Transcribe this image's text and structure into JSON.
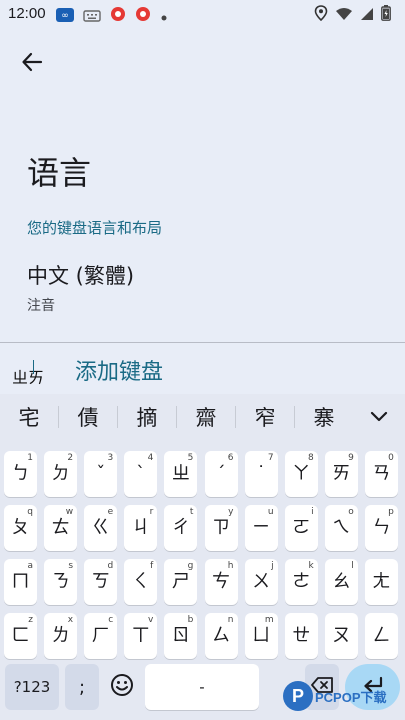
{
  "status_bar": {
    "time": "12:00",
    "left_icons": [
      "infinity-app-icon",
      "keyboard-notification-icon",
      "app-notification-icon",
      "app-notification-icon",
      "more-dot-icon"
    ],
    "right_icons": [
      "location-icon",
      "wifi-icon",
      "signal-icon",
      "battery-icon"
    ]
  },
  "header": {
    "back_icon": "arrow-back-icon"
  },
  "page": {
    "title": "语言",
    "section_label": "您的键盘语言和布局",
    "language_name": "中文 (繁體)",
    "language_layout": "注音",
    "add_keyboard": "添加键盘"
  },
  "composing_text": "ㄓㄞ",
  "candidates": [
    "宅",
    "債",
    "摘",
    "齋",
    "窄",
    "寨"
  ],
  "keyboard": {
    "rows": [
      [
        {
          "k": "ㄅ",
          "h": "1"
        },
        {
          "k": "ㄉ",
          "h": "2"
        },
        {
          "k": "ˇ",
          "h": "3"
        },
        {
          "k": "ˋ",
          "h": "4"
        },
        {
          "k": "ㄓ",
          "h": "5"
        },
        {
          "k": "ˊ",
          "h": "6"
        },
        {
          "k": "˙",
          "h": "7"
        },
        {
          "k": "ㄚ",
          "h": "8"
        },
        {
          "k": "ㄞ",
          "h": "9"
        },
        {
          "k": "ㄢ",
          "h": "0"
        }
      ],
      [
        {
          "k": "ㄆ",
          "h": "q"
        },
        {
          "k": "ㄊ",
          "h": "w"
        },
        {
          "k": "ㄍ",
          "h": "e"
        },
        {
          "k": "ㄐ",
          "h": "r"
        },
        {
          "k": "ㄔ",
          "h": "t"
        },
        {
          "k": "ㄗ",
          "h": "y"
        },
        {
          "k": "ㄧ",
          "h": "u"
        },
        {
          "k": "ㄛ",
          "h": "i"
        },
        {
          "k": "ㄟ",
          "h": "o"
        },
        {
          "k": "ㄣ",
          "h": "p"
        }
      ],
      [
        {
          "k": "ㄇ",
          "h": "a"
        },
        {
          "k": "ㄋ",
          "h": "s"
        },
        {
          "k": "ㄎ",
          "h": "d"
        },
        {
          "k": "ㄑ",
          "h": "f"
        },
        {
          "k": "ㄕ",
          "h": "g"
        },
        {
          "k": "ㄘ",
          "h": "h"
        },
        {
          "k": "ㄨ",
          "h": "j"
        },
        {
          "k": "ㄜ",
          "h": "k"
        },
        {
          "k": "ㄠ",
          "h": "l"
        },
        {
          "k": "ㄤ",
          "h": ""
        }
      ],
      [
        {
          "k": "ㄈ",
          "h": "z"
        },
        {
          "k": "ㄌ",
          "h": "x"
        },
        {
          "k": "ㄏ",
          "h": "c"
        },
        {
          "k": "ㄒ",
          "h": "v"
        },
        {
          "k": "ㄖ",
          "h": "b"
        },
        {
          "k": "ㄙ",
          "h": "n"
        },
        {
          "k": "ㄩ",
          "h": "m"
        },
        {
          "k": "ㄝ",
          "h": ""
        },
        {
          "k": "ㄡ",
          "h": ""
        },
        {
          "k": "ㄥ",
          "h": ""
        }
      ]
    ],
    "symbols_key": "?123",
    "comma_key": ";",
    "emoji_icon": "emoji-smile-icon",
    "space_key": "-",
    "enter_icon": "enter-return-icon",
    "backspace_icon": "backspace-icon"
  },
  "watermark": {
    "logo_letter": "P",
    "text": "PCPOP下载"
  },
  "colors": {
    "background": "#e8edf7",
    "accent": "#1a6a85",
    "key": "#ffffff"
  }
}
